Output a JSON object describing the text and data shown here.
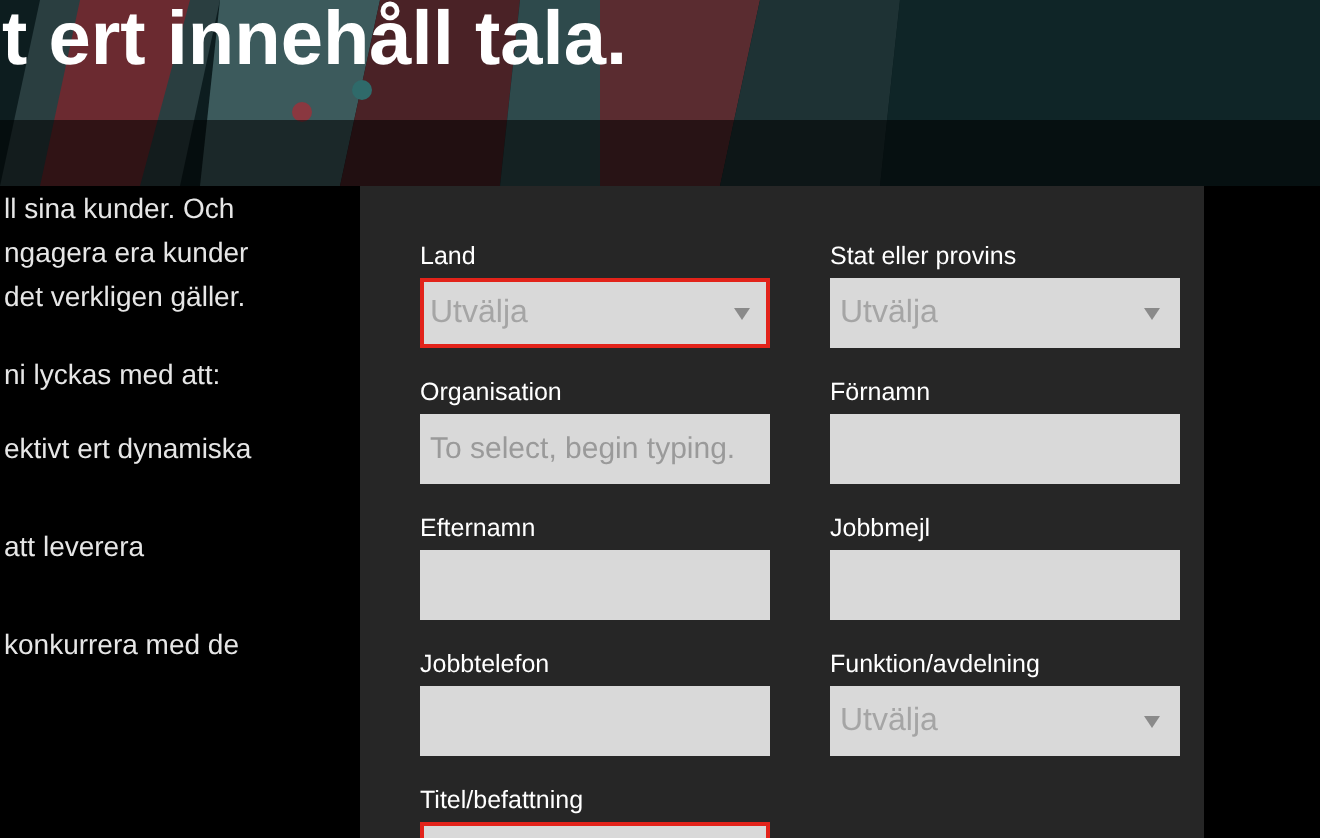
{
  "hero": {
    "kind": "picture",
    "headline": "t ert innehåll tala."
  },
  "intro": {
    "paragraph_lines": [
      "ll sina kunder. Och",
      "ngagera era kunder",
      "det verkligen gäller."
    ],
    "lead": "ni lyckas med att:",
    "items": [
      "ektivt ert dynamiska",
      "att leverera",
      "konkurrera med de"
    ]
  },
  "form": {
    "fields": [
      {
        "label": "Land",
        "kind": "select",
        "placeholder": "Utvälja",
        "invalid": true
      },
      {
        "label": "Stat eller provins",
        "kind": "select",
        "placeholder": "Utvälja",
        "invalid": false
      },
      {
        "label": "Organisation",
        "kind": "text",
        "placeholder": "To select, begin typing.",
        "invalid": false
      },
      {
        "label": "Förnamn",
        "kind": "text",
        "invalid": false
      },
      {
        "label": "Efternamn",
        "kind": "text",
        "invalid": false
      },
      {
        "label": "Jobbmejl",
        "kind": "text",
        "invalid": false
      },
      {
        "label": "Jobbtelefon",
        "kind": "text",
        "invalid": false
      },
      {
        "label": "Funktion/avdelning",
        "kind": "select",
        "placeholder": "Utvälja",
        "invalid": false
      },
      {
        "label": "Titel/befattning",
        "kind": "text",
        "invalid": true
      }
    ]
  }
}
